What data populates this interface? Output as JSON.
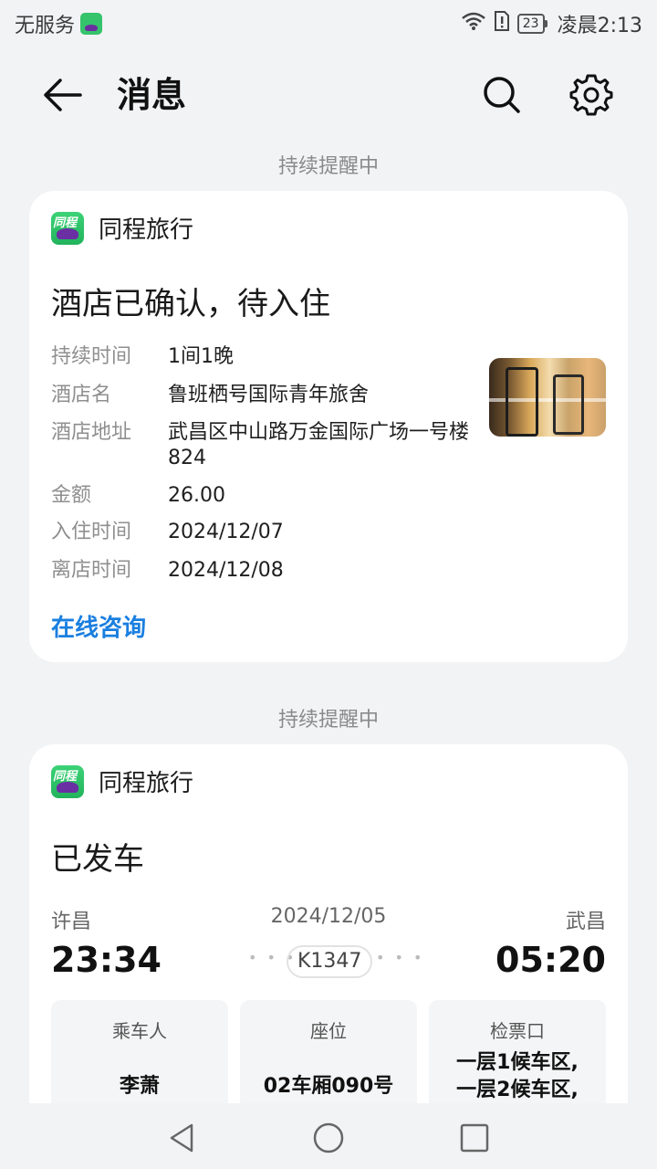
{
  "status_bar": {
    "carrier": "无服务",
    "battery": "23",
    "time": "凌晨2:13"
  },
  "app_bar": {
    "title": "消息"
  },
  "cards": [
    {
      "section_label": "持续提醒中",
      "app_name": "同程旅行",
      "app_icon_text": "同程",
      "title": "酒店已确认，待入住",
      "rows": [
        {
          "key": "持续时间",
          "value": "1间1晚"
        },
        {
          "key": "酒店名",
          "value": "鲁班栖号国际青年旅舍"
        },
        {
          "key": "酒店地址",
          "value": "武昌区中山路万金国际广场一号楼824"
        },
        {
          "key": "金额",
          "value": "26.00"
        },
        {
          "key": "入住时间",
          "value": "2024/12/07"
        },
        {
          "key": "离店时间",
          "value": "2024/12/08"
        }
      ],
      "link": "在线咨询"
    },
    {
      "section_label": "持续提醒中",
      "app_name": "同程旅行",
      "app_icon_text": "同程",
      "title": "已发车",
      "from_station": "许昌",
      "to_station": "武昌",
      "date": "2024/12/05",
      "depart_time": "23:34",
      "arrive_time": "05:20",
      "train_no": "K1347",
      "tiles": [
        {
          "label": "乘车人",
          "value": "李萧"
        },
        {
          "label": "座位",
          "value": "02车厢090号"
        },
        {
          "label": "检票口",
          "value_line1": "一层1候车区,",
          "value_line2": "一层2候车区,"
        }
      ]
    }
  ]
}
